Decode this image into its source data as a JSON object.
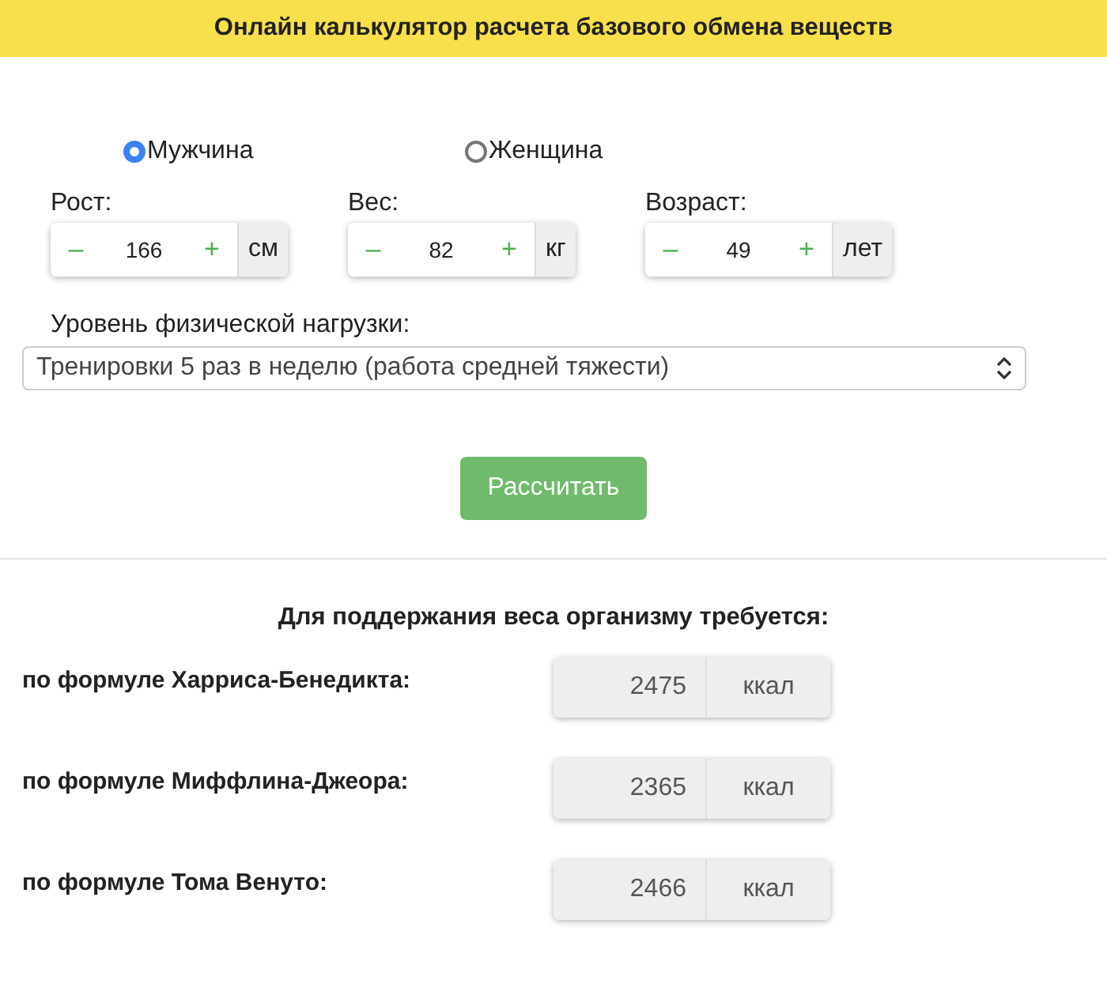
{
  "header": {
    "title": "Онлайн калькулятор расчета базового обмена веществ"
  },
  "gender": [
    {
      "label": "Мужчина",
      "selected": true
    },
    {
      "label": "Женщина",
      "selected": false
    }
  ],
  "params": [
    {
      "label": "Рост:",
      "minus": "–",
      "value": "166",
      "plus": "+",
      "unit": "см"
    },
    {
      "label": "Вес:",
      "minus": "–",
      "value": "82",
      "plus": "+",
      "unit": "кг"
    },
    {
      "label": "Возраст:",
      "minus": "–",
      "value": "49",
      "plus": "+",
      "unit": "лет"
    }
  ],
  "activity": {
    "label": "Уровень физической нагрузки:",
    "value": "Тренировки 5 раз в неделю (работа средней тяжести)"
  },
  "calculate_button": "Рассчитать",
  "results": {
    "heading": "Для поддержания веса организму требуется:",
    "rows": [
      {
        "label": "по формуле Харриса-Бенедикта:",
        "value": "2475",
        "unit": "ккал"
      },
      {
        "label": "по формуле Миффлина-Джеора:",
        "value": "2365",
        "unit": "ккал"
      },
      {
        "label": "по формуле Тома Венуто:",
        "value": "2466",
        "unit": "ккал"
      }
    ]
  }
}
